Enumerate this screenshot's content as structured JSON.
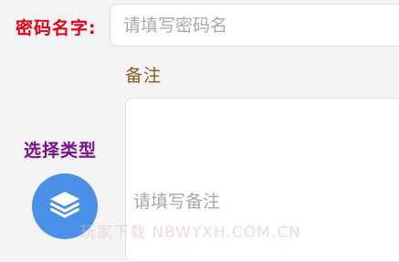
{
  "form": {
    "name_label": "密码名字:",
    "name_placeholder": "请填写密码名",
    "name_value": "",
    "remark_label": "备注",
    "remark_placeholder": "请填写备注",
    "remark_value": "",
    "type_label": "选择类型",
    "type_icon": "layers-icon"
  },
  "watermark": {
    "text": "玩家下载 NBWYXH.COM.CN"
  },
  "colors": {
    "name_label": "#e60012",
    "remark_label": "#8b5a14",
    "type_label": "#7a1090",
    "type_button": "#4a90e8"
  }
}
